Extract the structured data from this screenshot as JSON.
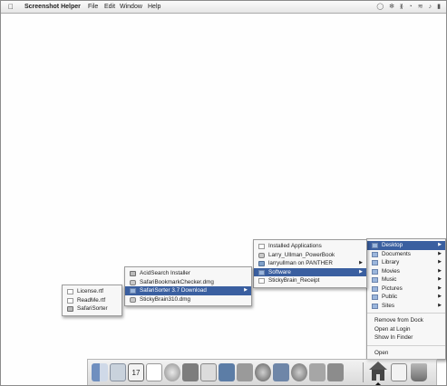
{
  "menubar": {
    "apple": "",
    "app_name": "Screenshot Helper",
    "menus": [
      "File",
      "Edit",
      "Window",
      "Help"
    ]
  },
  "folder_menu": {
    "items": [
      {
        "label": "Desktop",
        "icon": "folder-icon",
        "submenu": true,
        "selected": true
      },
      {
        "label": "Documents",
        "icon": "folder-icon",
        "submenu": true
      },
      {
        "label": "Library",
        "icon": "folder-icon",
        "submenu": true
      },
      {
        "label": "Movies",
        "icon": "folder-icon",
        "submenu": true
      },
      {
        "label": "Music",
        "icon": "folder-icon",
        "submenu": true
      },
      {
        "label": "Pictures",
        "icon": "folder-icon",
        "submenu": true
      },
      {
        "label": "Public",
        "icon": "folder-icon",
        "submenu": true
      },
      {
        "label": "Sites",
        "icon": "folder-icon",
        "submenu": true
      }
    ],
    "commands": [
      "Remove from Dock",
      "Open at Login",
      "Show In Finder",
      "Open"
    ]
  },
  "desktop_menu": {
    "items": [
      {
        "label": "Installed Applications",
        "icon": "document-icon"
      },
      {
        "label": "Larry_Ullman_PowerBook",
        "icon": "disk-icon"
      },
      {
        "label": "larryullman on PANTHER",
        "icon": "network-volume-icon",
        "submenu": true
      },
      {
        "label": "Software",
        "icon": "folder-icon",
        "submenu": true,
        "selected": true
      },
      {
        "label": "StickyBrain_Receipt",
        "icon": "document-icon"
      }
    ]
  },
  "software_menu": {
    "items": [
      {
        "label": "AcidSearch Installer",
        "icon": "application-icon"
      },
      {
        "label": "SafariBookmarkChecker.dmg",
        "icon": "disk-image-icon"
      },
      {
        "label": "SafariSorter 3.7 Download",
        "icon": "folder-icon",
        "submenu": true,
        "selected": true
      },
      {
        "label": "StickyBrain310.dmg",
        "icon": "disk-image-icon"
      }
    ]
  },
  "safarisorter_menu": {
    "items": [
      {
        "label": "License.rtf",
        "icon": "document-icon"
      },
      {
        "label": "ReadMe.rtf",
        "icon": "document-icon"
      },
      {
        "label": "SafariSorter",
        "icon": "application-icon"
      }
    ]
  },
  "dock": {
    "icons": [
      "finder-icon",
      "mail-icon",
      "ical-icon",
      "blank-document-icon",
      "safari-icon",
      "address-book-icon",
      "itunes-icon",
      "iphoto-icon",
      "imovie-icon",
      "quicktime-icon",
      "ichat-icon",
      "system-preferences-icon",
      "xcode-icon",
      "home-folder-icon",
      "document-icon",
      "trash-icon"
    ]
  }
}
